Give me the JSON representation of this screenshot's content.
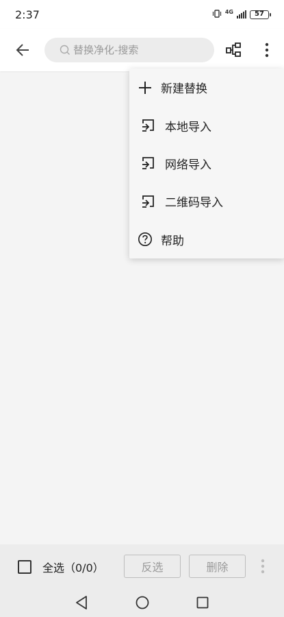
{
  "status_bar": {
    "time": "2:37",
    "network": "4G",
    "battery": "57"
  },
  "toolbar": {
    "search_placeholder": "替换净化-搜索"
  },
  "menu": {
    "items": [
      {
        "label": "新建替换",
        "icon": "plus-icon"
      },
      {
        "label": "本地导入",
        "icon": "import-icon"
      },
      {
        "label": "网络导入",
        "icon": "import-icon"
      },
      {
        "label": "二维码导入",
        "icon": "import-icon"
      },
      {
        "label": "帮助",
        "icon": "help-circle-icon"
      }
    ]
  },
  "bottom_bar": {
    "select_all_label": "全选（0/0）",
    "invert_label": "反选",
    "delete_label": "删除"
  },
  "colors": {
    "background": "#f4f4f4",
    "toolbar": "#ffffff",
    "menu": "#f6f6f6",
    "bottom_bar": "#ececec",
    "disabled_text": "#9a9a9a"
  }
}
